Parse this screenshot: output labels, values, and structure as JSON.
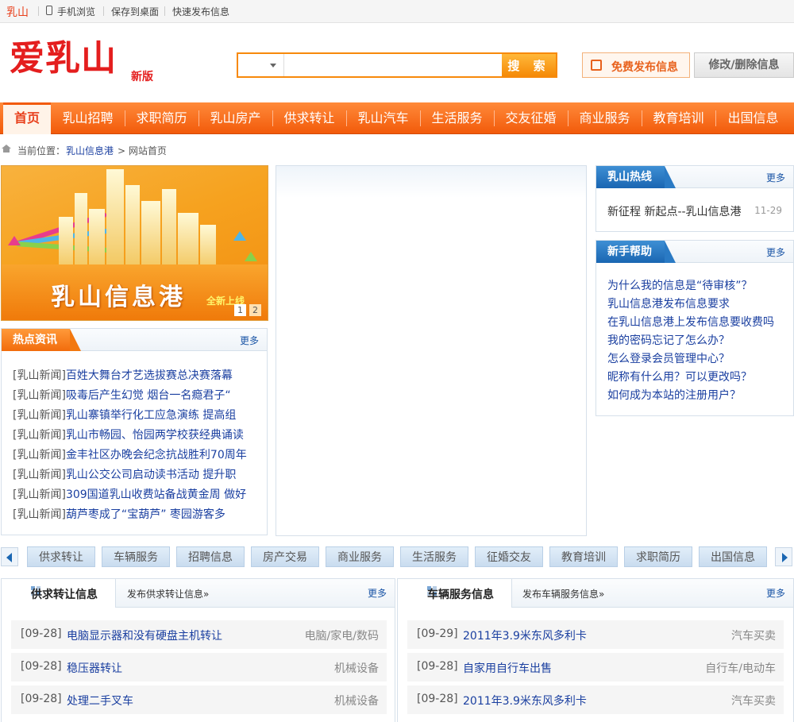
{
  "topbar": {
    "city": "乳山",
    "links": [
      "手机浏览",
      "保存到桌面",
      "快速发布信息"
    ]
  },
  "header": {
    "logo": "爱乳山",
    "logo_sub": "新版",
    "search_placeholder": "",
    "search_button": "搜 索",
    "publish_button": "免费发布信息",
    "edit_button": "修改/删除信息",
    "brand_color": "#e41e1e",
    "accent_color": "#f25a0a"
  },
  "nav": {
    "items": [
      "首页",
      "乳山招聘",
      "求职简历",
      "乳山房产",
      "供求转让",
      "乳山汽车",
      "生活服务",
      "交友征婚",
      "商业服务",
      "教育培训",
      "出国信息"
    ]
  },
  "breadcrumb": {
    "label": "当前位置：",
    "link": "乳山信息港",
    "current": "> 网站首页"
  },
  "slideshow": {
    "title": "乳山信息港",
    "subtitle": "全新上线",
    "pages": [
      "1",
      "2"
    ]
  },
  "hot_news": {
    "title": "热点资讯",
    "more": "更多",
    "items": [
      {
        "cat": "[乳山新闻]",
        "title": "百姓大舞台才艺选拔赛总决赛落幕"
      },
      {
        "cat": "[乳山新闻]",
        "title": "吸毒后产生幻觉 烟台一名瘾君子“"
      },
      {
        "cat": "[乳山新闻]",
        "title": "乳山寨镇举行化工应急演练 提高组"
      },
      {
        "cat": "[乳山新闻]",
        "title": "乳山市畅园、怡园两学校获经典诵读"
      },
      {
        "cat": "[乳山新闻]",
        "title": "金丰社区办晚会纪念抗战胜利70周年"
      },
      {
        "cat": "[乳山新闻]",
        "title": "乳山公交公司启动读书活动 提升职"
      },
      {
        "cat": "[乳山新闻]",
        "title": "309国道乳山收费站备战黄金周 做好"
      },
      {
        "cat": "[乳山新闻]",
        "title": "葫芦枣成了“宝葫芦” 枣园游客多"
      }
    ]
  },
  "hotline": {
    "title": "乳山热线",
    "more": "更多",
    "items": [
      {
        "title": "新征程 新起点--乳山信息港",
        "date": "11-29"
      }
    ]
  },
  "help": {
    "title": "新手帮助",
    "more": "更多",
    "items": [
      "为什么我的信息是“待审核”？",
      "乳山信息港发布信息要求",
      "在乳山信息港上发布信息要收费吗",
      "我的密码忘记了怎么办？",
      "怎么登录会员管理中心？",
      "昵称有什么用？可以更改吗？",
      "如何成为本站的注册用户？"
    ]
  },
  "categories": [
    "供求转让",
    "车辆服务",
    "招聘信息",
    "房产交易",
    "商业服务",
    "生活服务",
    "征婚交友",
    "教育培训",
    "求职简历",
    "出国信息"
  ],
  "sections": [
    {
      "title": "供求转让信息",
      "link": "发布供求转让信息»",
      "more": "更多",
      "rows": [
        {
          "date": "[09-28]",
          "title": "电脑显示器和没有硬盘主机转让",
          "cat": "电脑/家电/数码"
        },
        {
          "date": "[09-28]",
          "title": "稳压器转让",
          "cat": "机械设备"
        },
        {
          "date": "[09-28]",
          "title": "处理二手叉车",
          "cat": "机械设备"
        }
      ]
    },
    {
      "title": "车辆服务信息",
      "link": "发布车辆服务信息»",
      "more": "更多",
      "rows": [
        {
          "date": "[09-29]",
          "title": "2011年3.9米东风多利卡",
          "cat": "汽车买卖"
        },
        {
          "date": "[09-28]",
          "title": "自家用自行车出售",
          "cat": "自行车/电动车"
        },
        {
          "date": "[09-28]",
          "title": "2011年3.9米东风多利卡",
          "cat": "汽车买卖"
        }
      ]
    }
  ]
}
